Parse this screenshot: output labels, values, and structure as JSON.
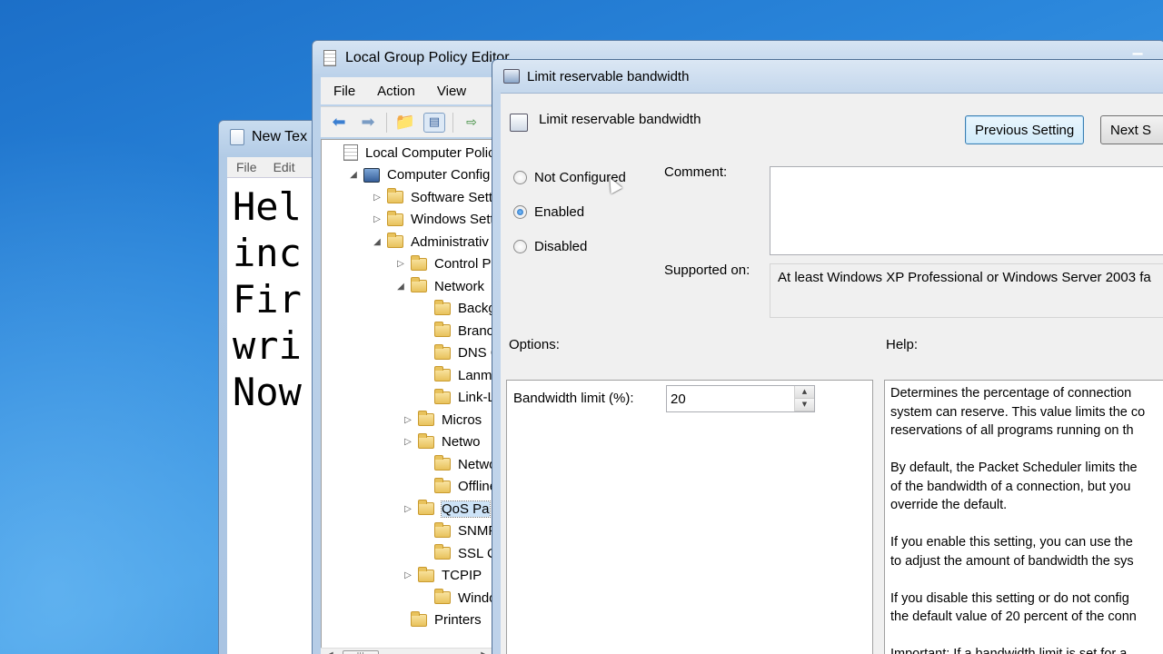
{
  "notepad": {
    "title": "New Tex",
    "menu": [
      "File",
      "Edit"
    ],
    "lines": [
      "Hel",
      "inc",
      "Fir",
      "wri",
      "Now"
    ]
  },
  "gpe": {
    "title": "Local Group Policy Editor",
    "menu": [
      "File",
      "Action",
      "View"
    ],
    "tree": [
      {
        "label": "Local Computer Polic",
        "icon": "doc-icon",
        "expander": ""
      },
      {
        "label": "Computer Config",
        "icon": "computer-icon",
        "expander": "◢"
      },
      {
        "label": "Software Setti",
        "icon": "folder-icon",
        "expander": "▷"
      },
      {
        "label": "Windows Sett",
        "icon": "folder-icon",
        "expander": "▷"
      },
      {
        "label": "Administrativ",
        "icon": "folder-icon",
        "expander": "◢"
      },
      {
        "label": "Control Pa",
        "icon": "folder-icon",
        "expander": "▷"
      },
      {
        "label": "Network",
        "icon": "folder-icon",
        "expander": "◢"
      },
      {
        "label": "Backgr",
        "icon": "folder-icon",
        "expander": ""
      },
      {
        "label": "Branch",
        "icon": "folder-icon",
        "expander": ""
      },
      {
        "label": "DNS C",
        "icon": "folder-icon",
        "expander": ""
      },
      {
        "label": "Lanma",
        "icon": "folder-icon",
        "expander": ""
      },
      {
        "label": "Link-L",
        "icon": "folder-icon",
        "expander": ""
      },
      {
        "label": "Micros",
        "icon": "folder-icon",
        "expander": "▷"
      },
      {
        "label": "Netwo",
        "icon": "folder-icon",
        "expander": "▷"
      },
      {
        "label": "Netwo",
        "icon": "folder-icon",
        "expander": ""
      },
      {
        "label": "Offline",
        "icon": "folder-icon",
        "expander": ""
      },
      {
        "label": "QoS Pa",
        "icon": "folder-icon",
        "expander": "▷",
        "selected": true
      },
      {
        "label": "SNMP",
        "icon": "folder-icon",
        "expander": ""
      },
      {
        "label": "SSL Co",
        "icon": "folder-icon",
        "expander": ""
      },
      {
        "label": "TCPIP",
        "icon": "folder-icon",
        "expander": "▷"
      },
      {
        "label": "Windo",
        "icon": "folder-icon",
        "expander": ""
      },
      {
        "label": "Printers",
        "icon": "folder-icon",
        "expander": ""
      }
    ]
  },
  "dialog": {
    "title": "Limit reservable bandwidth",
    "setting_title": "Limit reservable bandwidth",
    "prev_button": "Previous Setting",
    "next_button": "Next S",
    "radios": [
      {
        "label": "Not Configured",
        "checked": false
      },
      {
        "label": "Enabled",
        "checked": true
      },
      {
        "label": "Disabled",
        "checked": false
      }
    ],
    "comment_label": "Comment:",
    "supported_label": "Supported on:",
    "supported_value": "At least Windows XP Professional or Windows Server 2003 fa",
    "options_label": "Options:",
    "help_label": "Help:",
    "bandwidth_label": "Bandwidth limit (%):",
    "bandwidth_value": "20",
    "help_paragraphs": [
      [
        "Determines the percentage of connection",
        "system can reserve. This value limits the co",
        "reservations of all programs running on th"
      ],
      [
        "By default, the Packet Scheduler limits the",
        "of the bandwidth of a connection, but you",
        "override the default."
      ],
      [
        "If you enable this setting, you can use the",
        "to adjust the amount of bandwidth the sys"
      ],
      [
        "If you disable this setting or do not config",
        "the default value of 20 percent of the conn"
      ],
      [
        "Important: If a bandwidth limit is set for a"
      ]
    ]
  }
}
